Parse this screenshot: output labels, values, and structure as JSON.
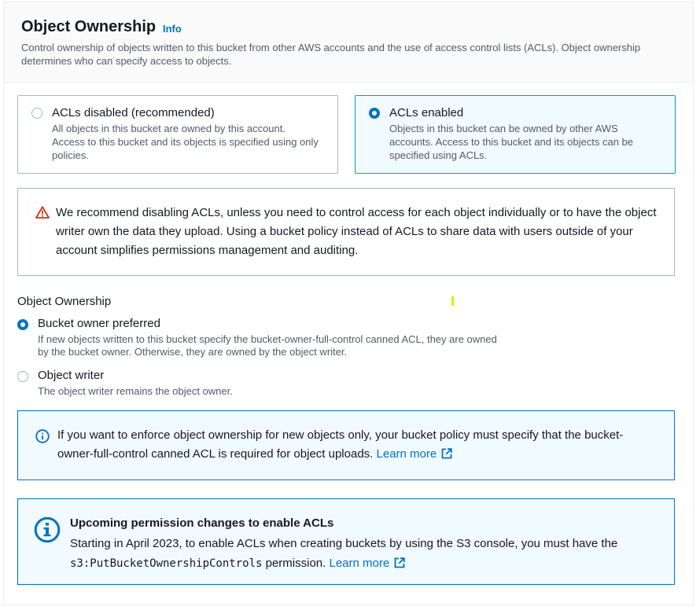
{
  "header": {
    "title": "Object Ownership",
    "info_link": "Info",
    "description": "Control ownership of objects written to this bucket from other AWS accounts and the use of access control lists (ACLs). Object ownership determines who can specify access to objects."
  },
  "acl_tiles": [
    {
      "label": "ACLs disabled (recommended)",
      "description": "All objects in this bucket are owned by this account. Access to this bucket and its objects is specified using only policies.",
      "selected": false
    },
    {
      "label": "ACLs enabled",
      "description": "Objects in this bucket can be owned by other AWS accounts. Access to this bucket and its objects can be specified using ACLs.",
      "selected": true
    }
  ],
  "warning": {
    "text": "We recommend disabling ACLs, unless you need to control access for each object individually or to have the object writer own the data they upload. Using a bucket policy instead of ACLs to share data with users outside of your account simplifies permissions management and auditing."
  },
  "ownership": {
    "label": "Object Ownership",
    "options": [
      {
        "label": "Bucket owner preferred",
        "description": "If new objects written to this bucket specify the bucket-owner-full-control canned ACL, they are owned by the bucket owner. Otherwise, they are owned by the object writer.",
        "selected": true
      },
      {
        "label": "Object writer",
        "description": "The object writer remains the object owner.",
        "selected": false
      }
    ]
  },
  "info_alert": {
    "text": "If you want to enforce object ownership for new objects only, your bucket policy must specify that the bucket-owner-full-control canned ACL is required for object uploads.",
    "link": "Learn more"
  },
  "notice": {
    "title": "Upcoming permission changes to enable ACLs",
    "text_before": "Starting in April 2023, to enable ACLs when creating buckets by using the S3 console, you must have the",
    "code": "s3:PutBucketOwnershipControls",
    "text_after": "permission.",
    "link": "Learn more"
  },
  "colors": {
    "accent": "#0073bb",
    "selected_border": "#00a1c9",
    "info_bg": "#f1faff",
    "warning": "#d13212"
  },
  "icons": [
    "warning-icon",
    "info-icon",
    "external-link-icon"
  ]
}
